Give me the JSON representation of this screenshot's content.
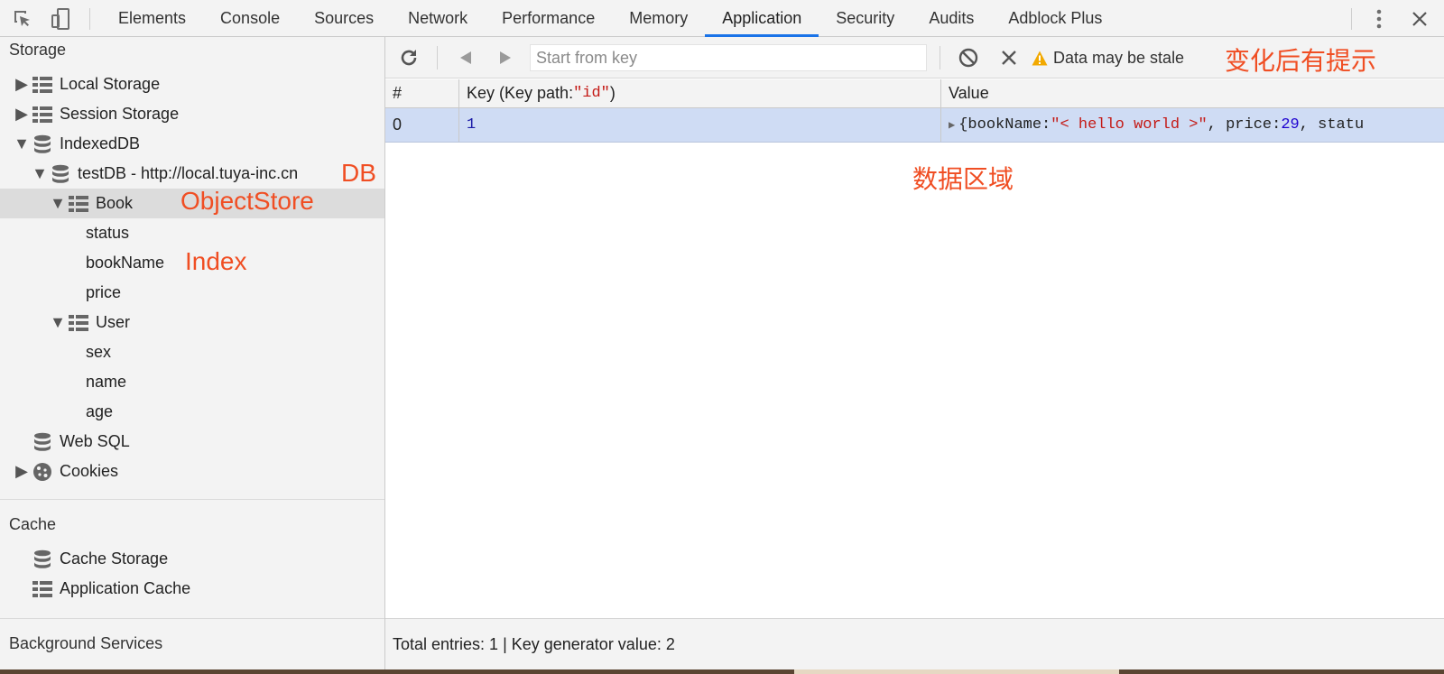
{
  "tabs": [
    "Elements",
    "Console",
    "Sources",
    "Network",
    "Performance",
    "Memory",
    "Application",
    "Security",
    "Audits",
    "Adblock Plus"
  ],
  "active_tab": "Application",
  "sidebar": {
    "storage_title": "Storage",
    "local_storage": "Local Storage",
    "session_storage": "Session Storage",
    "indexeddb": "IndexedDB",
    "db_name": "testDB - http://local.tuya-inc.cn",
    "store_book": "Book",
    "book_indexes": [
      "status",
      "bookName",
      "price"
    ],
    "store_user": "User",
    "user_indexes": [
      "sex",
      "name",
      "age"
    ],
    "web_sql": "Web SQL",
    "cookies": "Cookies",
    "cache_title": "Cache",
    "cache_storage": "Cache Storage",
    "application_cache": "Application Cache",
    "background_title": "Background Services"
  },
  "annotations": {
    "db": "DB",
    "object_store": "ObjectStore",
    "index": "Index",
    "stale_hint": "变化后有提示",
    "data_area": "数据区域"
  },
  "toolbar": {
    "key_placeholder": "Start from key",
    "stale_text": "Data may be stale"
  },
  "grid": {
    "col_num": "#",
    "col_key_prefix": "Key (Key path: ",
    "col_key_path": "\"id\"",
    "col_key_suffix": ")",
    "col_value": "Value",
    "rows": [
      {
        "num": "0",
        "key": "1",
        "value_open": "{bookName: ",
        "value_book": "\"< hello world >\"",
        "value_mid": ", price: ",
        "value_price": "29",
        "value_tail": ", statu"
      }
    ]
  },
  "footer": {
    "summary": "Total entries: 1 | Key generator value: 2"
  },
  "colors": {
    "annotation": "#f04e23",
    "active_tab_underline": "#1a73e8",
    "selected_row": "#cfdcf4"
  },
  "icons": {
    "inspect": "inspect-element-icon",
    "device": "device-toolbar-icon",
    "more": "more-vertical-icon",
    "close": "close-icon",
    "refresh": "refresh-icon",
    "prev": "prev-icon",
    "next": "next-icon",
    "clear": "clear-icon",
    "delete": "delete-icon",
    "warning": "warning-icon",
    "grid": "grid-icon",
    "database": "database-icon",
    "cookie": "cookie-icon"
  }
}
